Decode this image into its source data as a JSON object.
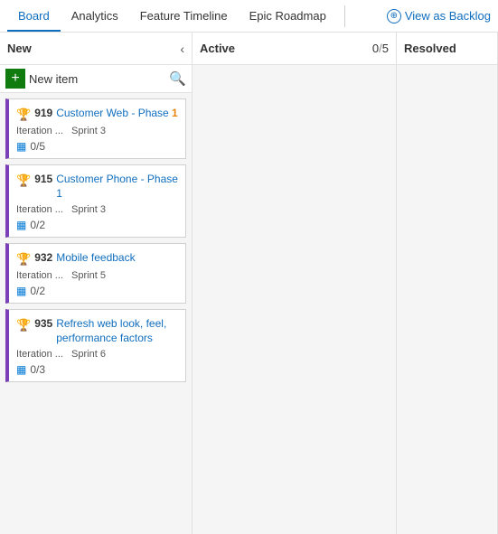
{
  "nav": {
    "tabs": [
      {
        "label": "Board",
        "active": true
      },
      {
        "label": "Analytics",
        "active": false
      },
      {
        "label": "Feature Timeline",
        "active": false
      },
      {
        "label": "Epic Roadmap",
        "active": false
      }
    ],
    "view_as_backlog": "View as Backlog"
  },
  "columns": [
    {
      "id": "new",
      "title": "New",
      "count": null,
      "toolbar": {
        "add_label": "+",
        "new_item": "New item",
        "search_icon": "🔍"
      }
    },
    {
      "id": "active",
      "title": "Active",
      "count_current": "0",
      "count_max": "5"
    },
    {
      "id": "resolved",
      "title": "Resolved",
      "count": null
    }
  ],
  "cards": [
    {
      "id": "919",
      "title_plain": "Customer Web - Phase ",
      "title_highlight": "1",
      "iteration": "Iteration ...",
      "sprint": "Sprint 3",
      "tasks": "0/5"
    },
    {
      "id": "915",
      "title_plain": "Customer Phone - Phase 1",
      "title_highlight": null,
      "iteration": "Iteration ...",
      "sprint": "Sprint 3",
      "tasks": "0/2"
    },
    {
      "id": "932",
      "title_plain": "Mobile feedback",
      "title_highlight": null,
      "iteration": "Iteration ...",
      "sprint": "Sprint 5",
      "tasks": "0/2"
    },
    {
      "id": "935",
      "title_plain": "Refresh web look, feel, performance factors",
      "title_highlight": null,
      "iteration": "Iteration ...",
      "sprint": "Sprint 6",
      "tasks": "0/3"
    }
  ],
  "icons": {
    "trophy": "🏆",
    "task": "📋",
    "chevron_left": "‹",
    "circle_arrow": "⊕"
  }
}
